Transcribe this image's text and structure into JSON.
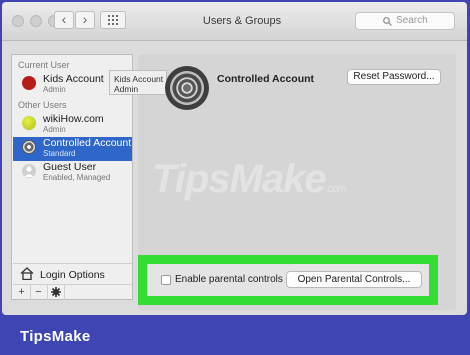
{
  "window": {
    "title": "Users & Groups"
  },
  "nav": {
    "back": "‹",
    "forward": "›"
  },
  "search": {
    "placeholder": "Search"
  },
  "sidebar": {
    "current_user_header": "Current User",
    "other_users_header": "Other Users",
    "users": [
      {
        "name": "Kids Account",
        "role": "Admin",
        "avatar_color": "#b51d1d"
      },
      {
        "name": "wikiHow.com",
        "role": "Admin",
        "avatar_color": "#c7d62a"
      },
      {
        "name": "Controlled Account",
        "role": "Standard",
        "avatar_color": "#8a8a8a",
        "selected": true
      },
      {
        "name": "Guest User",
        "role": "Enabled, Managed",
        "avatar_color": "#bcbcbc"
      }
    ],
    "login_options": "Login Options",
    "toolbar": {
      "add": "+",
      "remove": "−",
      "gear": "✱"
    }
  },
  "tooltip": {
    "line1": "Kids Account",
    "line2": "Admin"
  },
  "main": {
    "account_name": "Controlled Account",
    "reset_password": "Reset Password...",
    "enable_parental_controls": "Enable parental controls",
    "open_parental_controls": "Open Parental Controls..."
  },
  "watermark": {
    "text": "TipsMake",
    "suffix": ".com"
  },
  "footer": {
    "brand": "TipsMake"
  },
  "colors": {
    "highlight": "#33dd33",
    "selection": "#2f66c9",
    "background": "#3f45b3"
  }
}
